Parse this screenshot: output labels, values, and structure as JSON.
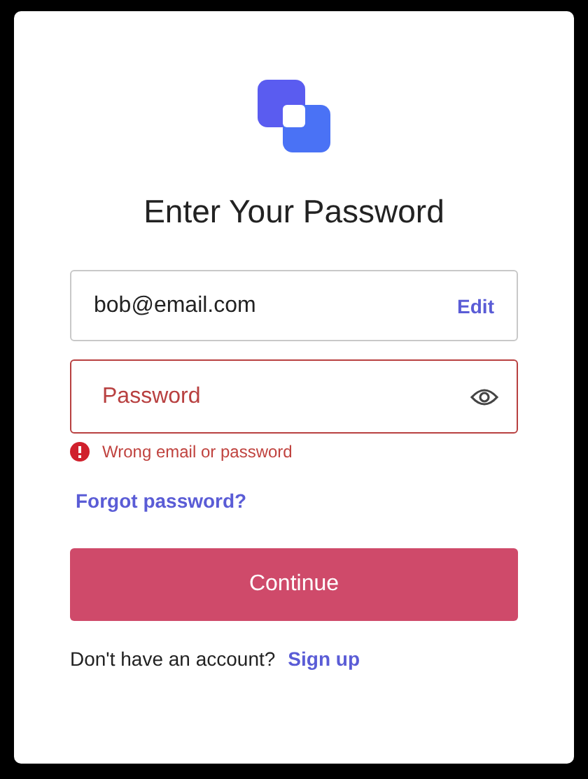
{
  "title": "Enter Your Password",
  "email": {
    "value": "bob@email.com",
    "edit_label": "Edit"
  },
  "password": {
    "placeholder": "Password",
    "invalid": true
  },
  "error_message": "Wrong email or password",
  "forgot_link": "Forgot password?",
  "continue_button": "Continue",
  "signup": {
    "prompt": "Don't have an account?",
    "link": "Sign up"
  }
}
